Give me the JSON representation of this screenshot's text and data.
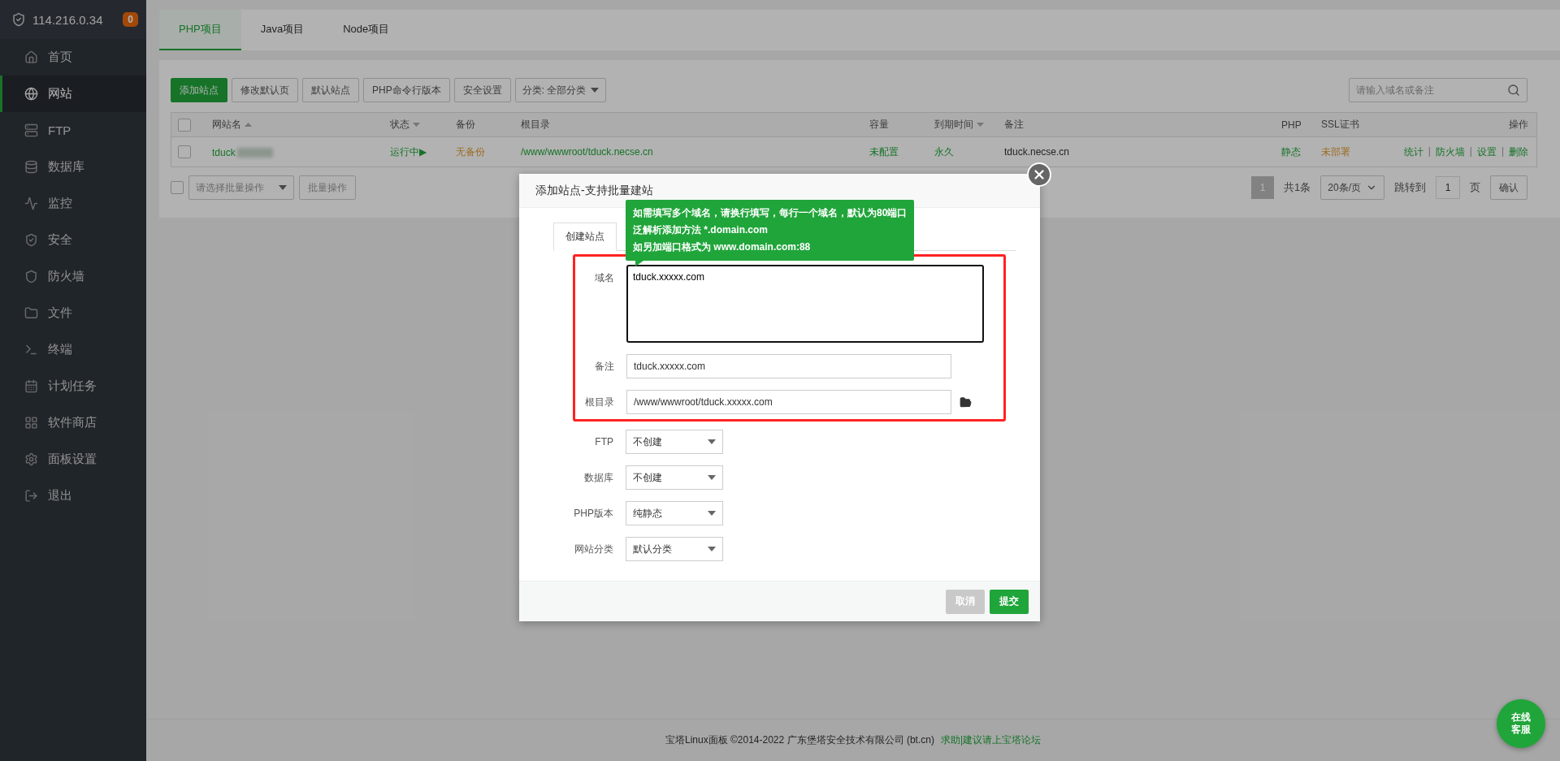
{
  "sidebar": {
    "server": "114.216.0.34",
    "badge": "0",
    "items": [
      {
        "label": "首页",
        "selected": false
      },
      {
        "label": "网站",
        "selected": true
      },
      {
        "label": "FTP",
        "selected": false
      },
      {
        "label": "数据库",
        "selected": false
      },
      {
        "label": "监控",
        "selected": false
      },
      {
        "label": "安全",
        "selected": false
      },
      {
        "label": "防火墙",
        "selected": false
      },
      {
        "label": "文件",
        "selected": false
      },
      {
        "label": "终端",
        "selected": false
      },
      {
        "label": "计划任务",
        "selected": false
      },
      {
        "label": "软件商店",
        "selected": false
      },
      {
        "label": "面板设置",
        "selected": false
      },
      {
        "label": "退出",
        "selected": false
      }
    ]
  },
  "project_tabs": [
    {
      "label": "PHP项目",
      "selected": true
    },
    {
      "label": "Java项目",
      "selected": false
    },
    {
      "label": "Node项目",
      "selected": false
    }
  ],
  "toolbar": {
    "buttons": [
      {
        "label": "添加站点",
        "kind": "primary"
      },
      {
        "label": "修改默认页",
        "kind": "default"
      },
      {
        "label": "默认站点",
        "kind": "default"
      },
      {
        "label": "PHP命令行版本",
        "kind": "default"
      },
      {
        "label": "安全设置",
        "kind": "default"
      }
    ],
    "category": "分类: 全部分类",
    "search_placeholder": "请输入域名或备注"
  },
  "table": {
    "select_all_checked": false,
    "columns": [
      {
        "label": "网站名",
        "kind": "ascending"
      },
      {
        "label": "状态",
        "kind": "descending"
      },
      {
        "label": "备份",
        "kind": "plain"
      },
      {
        "label": "根目录",
        "kind": "plain"
      },
      {
        "label": "容量",
        "kind": "plain"
      },
      {
        "label": "到期时间",
        "kind": "descending"
      },
      {
        "label": "备注",
        "kind": "plain"
      },
      {
        "label": "PHP",
        "kind": "plain"
      },
      {
        "label": "SSL证书",
        "kind": "plain"
      },
      {
        "label": "操作",
        "kind": "plain"
      }
    ],
    "rows": [
      {
        "checked": false,
        "name": "tduck",
        "status": "运行中▶",
        "backup": "无备份",
        "root": "/www/wwwroot/tduck.necse.cn",
        "quota": "未配置",
        "expiry": "永久",
        "note": "tduck.necse.cn",
        "php": "静态",
        "ssl": "未部署",
        "actions": [
          "统计",
          "|",
          "防火墙",
          "|",
          "设置",
          "|",
          "删除"
        ]
      }
    ]
  },
  "batch": {
    "checked": false,
    "placeholder": "请选择批量操作",
    "button": "批量操作"
  },
  "pagination": {
    "current": "1",
    "total": "共1条",
    "per_page": "20条/页",
    "goto_label": "跳转到",
    "goto_value": "1",
    "page_unit": "页",
    "confirm": "确认"
  },
  "dialog": {
    "title": "添加站点-支持批量建站",
    "tabs": [
      {
        "label": "创建站点",
        "selected": true
      }
    ],
    "tooltip": [
      "如需填写多个域名，请换行填写，每行一个域名，默认为80端口",
      "泛解析添加方法 *.domain.com",
      "如另加端口格式为 www.domain.com:88"
    ],
    "highlighted_fields": [
      {
        "label": "域名",
        "kind": "textarea",
        "value": "tduck.xxxxx.com"
      },
      {
        "label": "备注",
        "kind": "input",
        "value": "tduck.xxxxx.com"
      },
      {
        "label": "根目录",
        "kind": "path",
        "value": "/www/wwwroot/tduck.xxxxx.com"
      }
    ],
    "fields": [
      {
        "label": "FTP",
        "kind": "select",
        "value": "不创建"
      },
      {
        "label": "数据库",
        "kind": "select",
        "value": "不创建"
      },
      {
        "label": "PHP版本",
        "kind": "select",
        "value": "纯静态"
      },
      {
        "label": "网站分类",
        "kind": "select",
        "value": "默认分类"
      }
    ],
    "buttons": [
      {
        "label": "取消",
        "disabled": true
      },
      {
        "label": "提交",
        "disabled": false
      }
    ]
  },
  "footer": {
    "copyright": "宝塔Linux面板 ©2014-2022 广东堡塔安全技术有限公司 (bt.cn)",
    "link": "求助|建议请上宝塔论坛"
  },
  "chat_button": "在线客服"
}
